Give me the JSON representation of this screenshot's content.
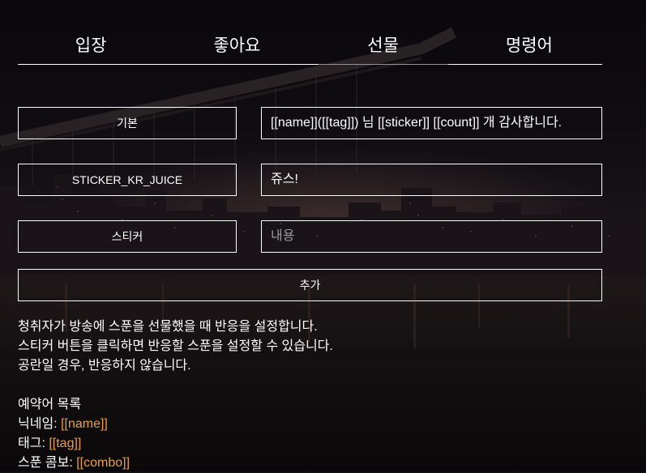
{
  "tabs": [
    {
      "label": "입장"
    },
    {
      "label": "좋아요"
    },
    {
      "label": "선물"
    },
    {
      "label": "명령어"
    }
  ],
  "active_tab": "선물",
  "rows": [
    {
      "key": "기본",
      "value": "[[name]]([[tag]]) 님 [[sticker]] [[count]] 개 감사합니다."
    },
    {
      "key": "STICKER_KR_JUICE",
      "value": "쥬스!"
    },
    {
      "key": "스티커",
      "value": "",
      "placeholder": "내용"
    }
  ],
  "add_button": "추가",
  "description": [
    "청취자가 방송에 스푼을 선물했을 때 반응을 설정합니다.",
    "스티커 버튼을 클릭하면 반응할 스푼을 설정할 수 있습니다.",
    "공란일 경우, 반응하지 않습니다."
  ],
  "reserved": {
    "title": "예약어 목록",
    "items": [
      {
        "label": "닉네임: ",
        "token": "[[name]]"
      },
      {
        "label": "태그: ",
        "token": "[[tag]]"
      },
      {
        "label": "스푼 콤보: ",
        "token": "[[combo]]"
      }
    ]
  },
  "colors": {
    "accent": "#e8a13c",
    "text": "#ffffff",
    "border": "#ffffff",
    "placeholder": "#9c9aa0"
  }
}
